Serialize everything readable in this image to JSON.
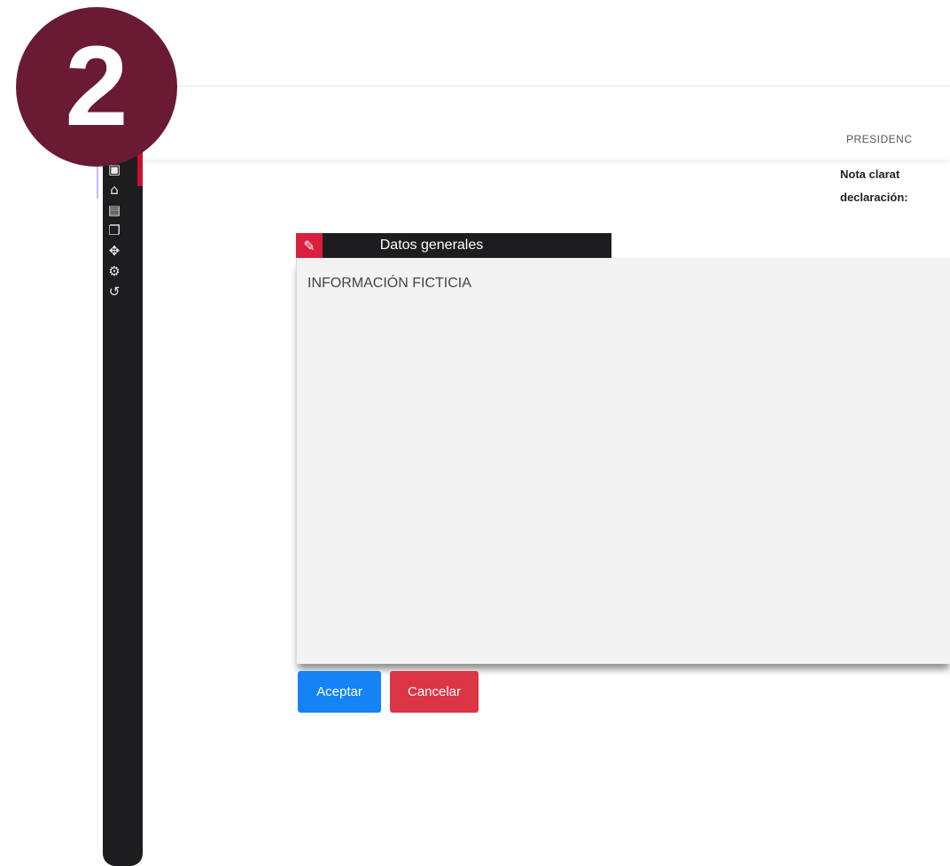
{
  "step_badge": "2",
  "header": {
    "org_label": "PRESIDENC",
    "note_line1": "Nota clarat",
    "note_line2": "declaración:"
  },
  "sidebar": {
    "items": [
      {
        "icon": "id-card-icon",
        "glyph": "▣"
      },
      {
        "icon": "home-info-icon",
        "glyph": "⌂"
      },
      {
        "icon": "document-icon",
        "glyph": "▤"
      },
      {
        "icon": "documents-icon",
        "glyph": "❐"
      },
      {
        "icon": "network-icon",
        "glyph": "✥"
      },
      {
        "icon": "search-settings-icon",
        "glyph": "⚙"
      },
      {
        "icon": "history-icon",
        "glyph": "↺"
      }
    ]
  },
  "dialog": {
    "title": "Datos generales",
    "content": "INFORMACIÓN FICTICIA"
  },
  "buttons": {
    "accept": "Aceptar",
    "cancel": "Cancelar"
  },
  "colors": {
    "badge": "#6b1a33",
    "accept": "#1583f5",
    "cancel": "#dc3545",
    "sidebar": "#1d1d1f",
    "accent": "#d91f3d"
  }
}
